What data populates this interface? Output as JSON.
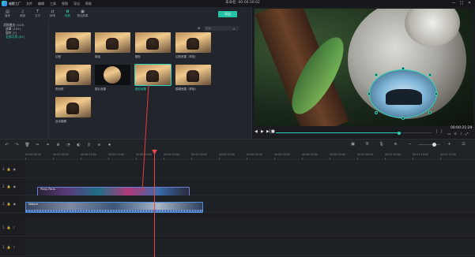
{
  "app": {
    "name": "喵影工厂",
    "project_title": "未命名: 00:00:30:02"
  },
  "menu": [
    "文件",
    "编辑",
    "工具",
    "视图",
    "导出",
    "帮助"
  ],
  "window_controls": [
    "—",
    "□",
    "✕"
  ],
  "toolbar": {
    "tabs": [
      {
        "label": "媒体",
        "icon": "▤"
      },
      {
        "label": "音频",
        "icon": "♫"
      },
      {
        "label": "文字",
        "icon": "T"
      },
      {
        "label": "转场",
        "icon": "⇄"
      },
      {
        "label": "特效",
        "icon": "✿"
      },
      {
        "label": "叠加效果",
        "icon": "▣"
      }
    ],
    "export_label": "导出"
  },
  "sidebar": {
    "items": [
      {
        "label": "滤镜叠加 (143)",
        "level": 0
      },
      {
        "label": "遮罩 (107)",
        "level": 1
      },
      {
        "label": "旋转 (7)",
        "level": 1
      },
      {
        "label": "全部可用 (81)",
        "level": 1,
        "active": true
      }
    ]
  },
  "search": {
    "placeholder": "搜索",
    "filter_icon": "⊞"
  },
  "effects": [
    {
      "label": "边框"
    },
    {
      "label": "原始"
    },
    {
      "label": "圆形"
    },
    {
      "label": "边框遮罩（样板）"
    },
    {
      "label": "斑驳框"
    },
    {
      "label": "图片遮罩"
    },
    {
      "label": "图形遮罩"
    },
    {
      "label": "模糊遮罩（样板）"
    },
    {
      "label": "自动模糊"
    }
  ],
  "preview": {
    "timecode": "00:00:21:29",
    "progress": 0.79
  },
  "timeline": {
    "ruler_ticks": [
      "00:00:00:00",
      "00:00:05:00",
      "00:00:10:00",
      "00:00:15:00",
      "00:00:20:00",
      "00:00:25:00",
      "00:00:30:00",
      "00:00:35:00",
      "00:00:40:00",
      "00:00:45:00",
      "00:00:50:00",
      "00:00:55:00",
      "00:01:00:00",
      "00:01:05:00",
      "00:01:10:00",
      "00:01:15:00"
    ],
    "tracks": [
      "3",
      "2",
      "1",
      "1",
      "1"
    ],
    "clips": {
      "top_label": "Pinky Paris",
      "bottom_label": "Nature"
    }
  }
}
